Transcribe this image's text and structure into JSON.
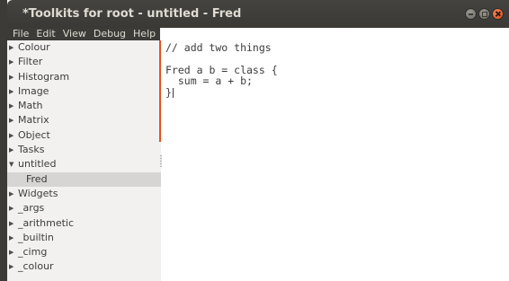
{
  "window": {
    "title": "*Toolkits for root - untitled - Fred",
    "controls": [
      "minimize-icon",
      "maximize-icon",
      "close-icon"
    ]
  },
  "menubar": {
    "items": [
      "File",
      "Edit",
      "View",
      "Debug",
      "Help"
    ]
  },
  "sidebar": {
    "items": [
      {
        "label": "Colour",
        "expanded": false
      },
      {
        "label": "Filter",
        "expanded": false
      },
      {
        "label": "Histogram",
        "expanded": false
      },
      {
        "label": "Image",
        "expanded": false
      },
      {
        "label": "Math",
        "expanded": false
      },
      {
        "label": "Matrix",
        "expanded": false
      },
      {
        "label": "Object",
        "expanded": false
      },
      {
        "label": "Tasks",
        "expanded": false
      },
      {
        "label": "untitled",
        "expanded": true
      },
      {
        "label": "Fred",
        "child": true,
        "selected": true
      },
      {
        "label": "Widgets",
        "expanded": false
      },
      {
        "label": "_args",
        "expanded": false
      },
      {
        "label": "_arithmetic",
        "expanded": false
      },
      {
        "label": "_builtin",
        "expanded": false
      },
      {
        "label": "_cimg",
        "expanded": false
      },
      {
        "label": "_colour",
        "expanded": false
      }
    ]
  },
  "editor": {
    "lines": [
      "// add two things",
      "",
      "Fred a b = class {",
      "  sum = a + b;",
      "}"
    ]
  },
  "colors": {
    "accent": "#e9501a",
    "titlebar": "#3c3b37",
    "sidebar_bg": "#f2f1f0",
    "selected_bg": "#d6d5d3"
  }
}
